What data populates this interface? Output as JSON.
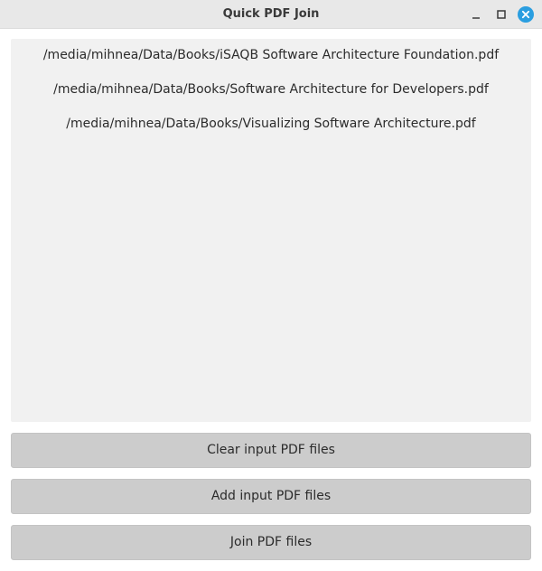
{
  "window": {
    "title": "Quick PDF Join",
    "controls": {
      "minimize_icon": "minimize-icon",
      "maximize_icon": "maximize-icon",
      "close_icon": "close-icon",
      "close_color": "#2a9ee0"
    }
  },
  "file_list": {
    "items": [
      "/media/mihnea/Data/Books/iSAQB Software Architecture Foundation.pdf",
      "/media/mihnea/Data/Books/Software Architecture for Developers.pdf",
      "/media/mihnea/Data/Books/Visualizing Software Architecture.pdf"
    ]
  },
  "actions": {
    "clear_label": "Clear input PDF files",
    "add_label": "Add input PDF files",
    "join_label": "Join PDF files"
  }
}
